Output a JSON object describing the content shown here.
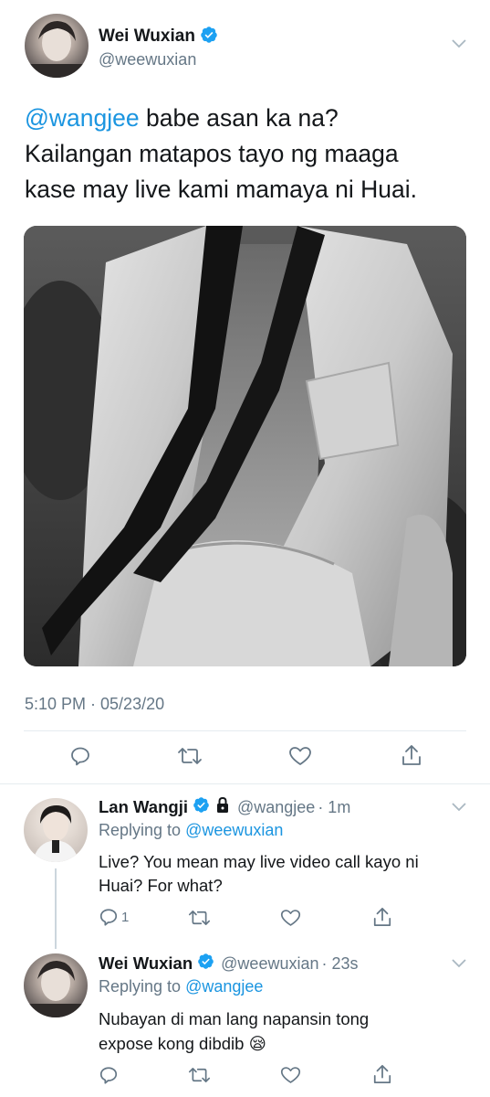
{
  "main_tweet": {
    "author_name": "Wei Wuxian",
    "handle": "@weewuxian",
    "mention": "@wangjee",
    "line1_rest": " babe asan ka na?",
    "line2": "Kailangan matapos tayo ng maaga",
    "line3": "kase may live kami mamaya ni Huai.",
    "timestamp": "5:10 PM · 05/23/20"
  },
  "replies": [
    {
      "author_name": "Lan Wangji",
      "handle": "@wangjee",
      "time": "· 1m",
      "replying_label": "Replying to",
      "replying_to": "@weewuxian",
      "text_line1": "Live? You mean may live video call kayo ni",
      "text_line2": "Huai? For what?",
      "reply_count": "1"
    },
    {
      "author_name": "Wei Wuxian",
      "handle": "@weewuxian",
      "time": "· 23s",
      "replying_label": "Replying to",
      "replying_to": "@wangjee",
      "text_line1": "Nubayan di man lang napansin tong",
      "text_line2": "expose kong dibdib 😪"
    }
  ],
  "icons": [
    "verified-badge-icon",
    "lock-icon",
    "chevron-down-icon",
    "reply-icon",
    "retweet-icon",
    "like-icon",
    "share-icon"
  ],
  "colors": {
    "link": "#1b95e0",
    "muted": "#657786",
    "divider": "#e6ecf0",
    "verified": "#1da1f2"
  }
}
